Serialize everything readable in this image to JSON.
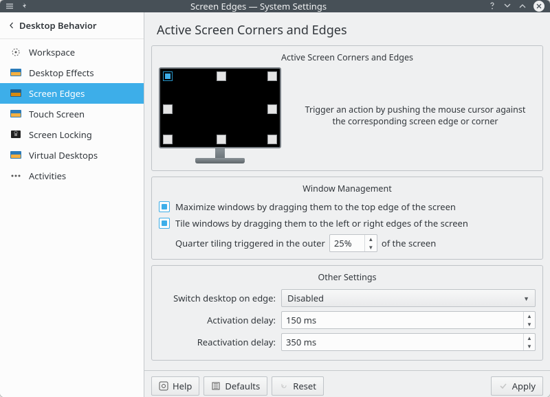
{
  "window": {
    "title": "Screen Edges — System Settings"
  },
  "sidebar": {
    "breadcrumb": "Desktop Behavior",
    "items": [
      {
        "label": "Workspace"
      },
      {
        "label": "Desktop Effects"
      },
      {
        "label": "Screen Edges"
      },
      {
        "label": "Touch Screen"
      },
      {
        "label": "Screen Locking"
      },
      {
        "label": "Virtual Desktops"
      },
      {
        "label": "Activities"
      }
    ]
  },
  "page": {
    "title": "Active Screen Corners and Edges",
    "edges": {
      "group_title": "Active Screen Corners and Edges",
      "hint": "Trigger an action by pushing the mouse cursor against the corresponding screen edge or corner"
    },
    "window_mgmt": {
      "group_title": "Window Management",
      "maximize_label": "Maximize windows by dragging them to the top edge of the screen",
      "maximize_checked": true,
      "tile_label": "Tile windows by dragging them to the left or right edges of the screen",
      "tile_checked": true,
      "quarter_prefix": "Quarter tiling triggered in the outer",
      "quarter_value": "25%",
      "quarter_suffix": "of the screen"
    },
    "other": {
      "group_title": "Other Settings",
      "switch_label": "Switch desktop on edge:",
      "switch_value": "Disabled",
      "activation_label": "Activation delay:",
      "activation_value": "150 ms",
      "reactivation_label": "Reactivation delay:",
      "reactivation_value": "350 ms"
    }
  },
  "footer": {
    "help": "Help",
    "defaults": "Defaults",
    "reset": "Reset",
    "apply": "Apply"
  }
}
